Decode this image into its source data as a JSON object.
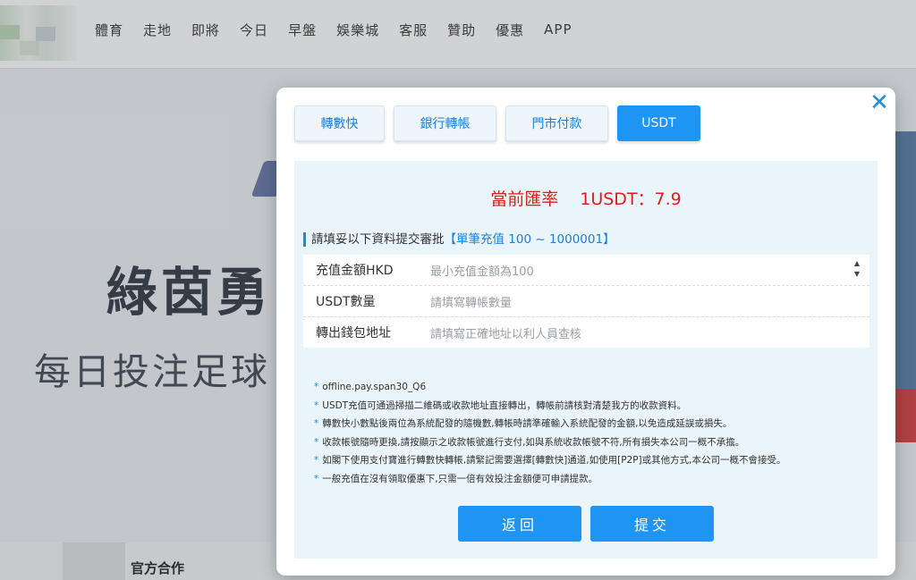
{
  "nav": {
    "links": [
      "體育",
      "走地",
      "即將",
      "今日",
      "早盤",
      "娛樂城",
      "客服",
      "贊助",
      "優惠",
      "APP"
    ]
  },
  "hero": {
    "title": "綠茵勇",
    "subtitle": "每日投注足球",
    "partner_label": "官方合作"
  },
  "modal": {
    "close_icon": "close-icon",
    "tabs": [
      {
        "label": "轉數快",
        "active": false
      },
      {
        "label": "銀行轉帳",
        "active": false
      },
      {
        "label": "門市付款",
        "active": false
      },
      {
        "label": "USDT",
        "active": true
      }
    ],
    "rate": {
      "label": "當前匯率",
      "value": "1USDT：7.9"
    },
    "section_title": "請填妥以下資料提交審批",
    "section_range": "【單筆充值 100 ~ 1000001】",
    "fields": [
      {
        "label": "充值金額HKD",
        "placeholder": "最小充值金額為100"
      },
      {
        "label": "USDT數量",
        "placeholder": "請填寫轉帳數量"
      },
      {
        "label": "轉出錢包地址",
        "placeholder": "請填寫正確地址以利人員查核"
      }
    ],
    "notes": [
      "offline.pay.span30_Q6",
      "USDT充值可通過掃描二維碼或收款地址直接轉出，轉帳前請核對清楚我方的收款資料。",
      "轉數快小數點後兩位為系統配發的隨機數,轉帳時請準確輸入系統配發的金額,以免造成延誤或損失。",
      "收款帳號隨時更換,請按顯示之收款帳號進行支付,如與系統收款帳號不符,所有損失本公司一概不承擔。",
      "如閣下使用支付寶進行轉數快轉帳,請緊記需要選擇[轉數快]通道,如使用[P2P]或其他方式,本公司一概不會接受。",
      "一般充值在沒有領取優惠下,只需一倍有效投注金額便可申請提款。"
    ],
    "back_label": "返回",
    "submit_label": "提交"
  }
}
